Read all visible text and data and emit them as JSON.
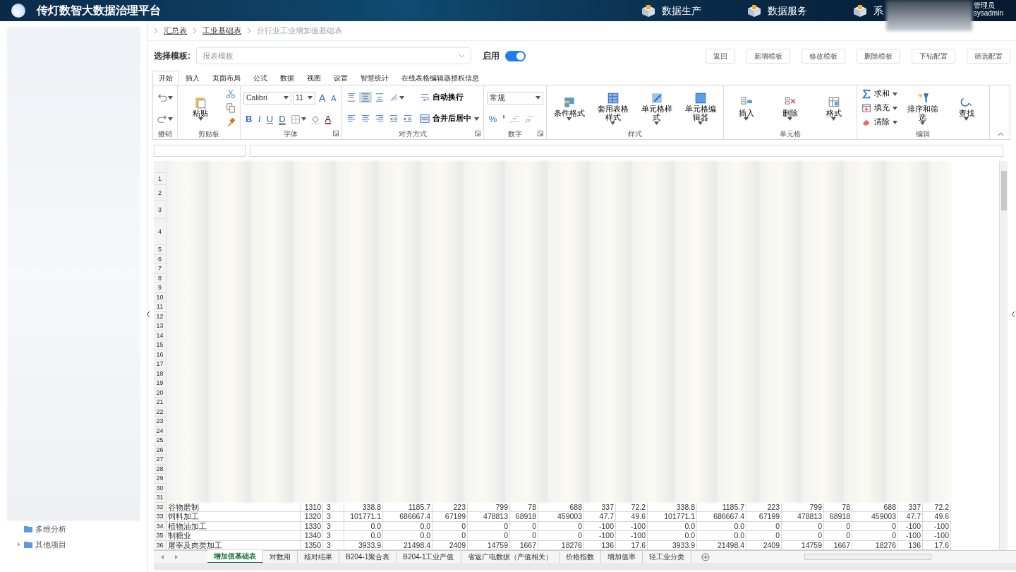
{
  "header": {
    "title": "传灯数智大数据治理平台",
    "nav": [
      {
        "label": "数据生产"
      },
      {
        "label": "数据服务"
      },
      {
        "label": "系"
      }
    ],
    "user": {
      "role": "管理员",
      "name": "sysadmin"
    }
  },
  "sidebar": {
    "items": [
      {
        "label": "多维分析",
        "expandable": false
      },
      {
        "label": "其他项目",
        "expandable": true
      }
    ]
  },
  "breadcrumb": [
    "汇总表",
    "工业基础表",
    "分行业工业增加值基础表"
  ],
  "template_bar": {
    "label": "选择模板:",
    "select": {
      "placeholder": "报表模板"
    },
    "switch": {
      "label": "启用",
      "on": true
    },
    "buttons": [
      "返回",
      "新增模板",
      "修改模板",
      "删除模板",
      "下钻配置",
      "筛选配置"
    ]
  },
  "ribbon": {
    "tabs": [
      {
        "label": "开始",
        "selected": true
      },
      {
        "label": "插入",
        "selected": false
      },
      {
        "label": "页面布局",
        "selected": false
      },
      {
        "label": "公式",
        "selected": false
      },
      {
        "label": "数据",
        "selected": false
      },
      {
        "label": "视图",
        "selected": false
      },
      {
        "label": "设置",
        "selected": false
      },
      {
        "label": "智慧统计",
        "selected": false
      },
      {
        "label": "在线表格编辑器授权信息",
        "selected": false
      }
    ],
    "groups": [
      {
        "label": "撤销",
        "launcher": false,
        "sections": [
          [
            [
              {
                "kind": "icon",
                "caret": true
              }
            ],
            [
              {
                "kind": "icon",
                "caret": true
              }
            ]
          ]
        ]
      },
      {
        "label": "剪贴板",
        "launcher": false,
        "sections": [
          [
            [
              {
                "kind": "big",
                "label": "粘贴",
                "caret": true
              }
            ]
          ],
          [
            [
              {
                "kind": "icon",
                "caret": false
              }
            ],
            [
              {
                "kind": "icon",
                "caret": false
              }
            ],
            [
              {
                "kind": "icon",
                "caret": false
              }
            ]
          ]
        ]
      },
      {
        "label": "字体",
        "launcher": true,
        "sections": [
          [
            [
              {
                "kind": "select",
                "value": "Calibri"
              },
              {
                "kind": "select",
                "value": "11"
              },
              {
                "kind": "glyph",
                "text": "A"
              },
              {
                "kind": "glyph",
                "text": "A"
              }
            ],
            [
              {
                "kind": "glyph",
                "text": "B"
              },
              {
                "kind": "glyph",
                "text": "I"
              },
              {
                "kind": "glyph",
                "text": "U"
              },
              {
                "kind": "glyph",
                "text": "D"
              },
              {
                "kind": "icon",
                "caret": true
              },
              {
                "kind": "icon",
                "caret": false
              },
              {
                "kind": "glyph",
                "text": "A"
              }
            ]
          ]
        ]
      },
      {
        "label": "对齐方式",
        "launcher": true,
        "sections": [
          [
            [
              {
                "kind": "toggle",
                "selected": false
              },
              {
                "kind": "toggle",
                "selected": true
              },
              {
                "kind": "toggle",
                "selected": false
              },
              {
                "kind": "icon",
                "caret": true
              }
            ],
            [
              {
                "kind": "toggle",
                "selected": false
              },
              {
                "kind": "toggle",
                "selected": false
              },
              {
                "kind": "toggle",
                "selected": false
              },
              {
                "kind": "icon",
                "caret": false
              },
              {
                "kind": "icon",
                "caret": false
              }
            ]
          ],
          [
            [
              {
                "kind": "small",
                "label": "自动换行",
                "caret": false
              }
            ],
            [
              {
                "kind": "small",
                "label": "合并后居中",
                "caret": true
              }
            ]
          ]
        ]
      },
      {
        "label": "数字",
        "launcher": true,
        "sections": [
          [
            [
              {
                "kind": "select",
                "value": "常规"
              }
            ],
            [
              {
                "kind": "glyph",
                "text": "%"
              },
              {
                "kind": "glyph",
                "text": "❜"
              },
              {
                "kind": "icon",
                "caret": false
              },
              {
                "kind": "icon",
                "caret": false
              }
            ]
          ]
        ]
      },
      {
        "label": "样式",
        "launcher": false,
        "sections": [
          [
            [
              {
                "kind": "big",
                "label": "条件格式",
                "caret": true
              }
            ]
          ],
          [
            [
              {
                "kind": "big",
                "label": "套用表格样式",
                "caret": true
              }
            ]
          ],
          [
            [
              {
                "kind": "big",
                "label": "单元格样式",
                "caret": true
              }
            ]
          ],
          [
            [
              {
                "kind": "big",
                "label": "单元格编辑器",
                "caret": true
              }
            ]
          ]
        ]
      },
      {
        "label": "单元格",
        "launcher": false,
        "sections": [
          [
            [
              {
                "kind": "big",
                "label": "插入",
                "caret": true
              }
            ]
          ],
          [
            [
              {
                "kind": "big",
                "label": "删除",
                "caret": true
              }
            ]
          ],
          [
            [
              {
                "kind": "big",
                "label": "格式",
                "caret": true
              }
            ]
          ]
        ]
      },
      {
        "label": "编辑",
        "launcher": false,
        "sections": [
          [
            [
              {
                "kind": "small",
                "label": "求和",
                "caret": true
              }
            ],
            [
              {
                "kind": "small",
                "label": "填充",
                "caret": true
              }
            ],
            [
              {
                "kind": "small",
                "label": "清除",
                "caret": true
              }
            ]
          ],
          [
            [
              {
                "kind": "big",
                "label": "排序和筛选",
                "caret": true
              }
            ]
          ],
          [
            [
              {
                "kind": "big",
                "label": "查找",
                "caret": true
              }
            ]
          ]
        ]
      }
    ]
  },
  "sheet": {
    "row_numbers": [
      "1",
      "2",
      "3",
      "4",
      "5",
      "6",
      "7",
      "8",
      "9",
      "10",
      "11",
      "12",
      "13",
      "14",
      "15",
      "16",
      "17",
      "18",
      "19",
      "20",
      "21",
      "22",
      "23",
      "24",
      "25",
      "26",
      "27",
      "28",
      "29",
      "30",
      "31"
    ],
    "rows": [
      {
        "number": "32",
        "cells": [
          "谷物磨制",
          "1310",
          "3",
          "338.8",
          "1185.7",
          "223",
          "799",
          "78",
          "688",
          "337",
          "72.2",
          "338.8",
          "1185.7",
          "223",
          "799",
          "78",
          "688",
          "337",
          "72.2"
        ]
      },
      {
        "number": "33",
        "cells": [
          "饲料加工",
          "1320",
          "3",
          "101771.1",
          "686667.4",
          "67199",
          "478813",
          "68918",
          "459003",
          "47.7",
          "49.6",
          "101771.1",
          "686667.4",
          "67199",
          "478813",
          "68918",
          "459003",
          "47.7",
          "49.6"
        ]
      },
      {
        "number": "34",
        "cells": [
          "植物油加工",
          "1330",
          "3",
          "0.0",
          "0.0",
          "0",
          "0",
          "0",
          "0",
          "-100",
          "-100",
          "0.0",
          "0.0",
          "0",
          "0",
          "0",
          "0",
          "-100",
          "-100"
        ]
      },
      {
        "number": "35",
        "cells": [
          "制糖业",
          "1340",
          "3",
          "0.0",
          "0.0",
          "0",
          "0",
          "0",
          "0",
          "-100",
          "-100",
          "0.0",
          "0.0",
          "0",
          "0",
          "0",
          "0",
          "-100",
          "-100"
        ]
      },
      {
        "number": "36",
        "cells": [
          "屠宰及肉类加工",
          "1350",
          "3",
          "3933.9",
          "21498.4",
          "2409",
          "14759",
          "1667",
          "18276",
          "136",
          "17.6",
          "3933.9",
          "21498.4",
          "2409",
          "14759",
          "1667",
          "18276",
          "136",
          "17.6"
        ]
      }
    ],
    "tabs": [
      {
        "label": "增加值基础表",
        "selected": true
      },
      {
        "label": "对数用",
        "selected": false
      },
      {
        "label": "核对结果",
        "selected": false
      },
      {
        "label": "B204-1聚合表",
        "selected": false
      },
      {
        "label": "B204-1工业产值",
        "selected": false
      },
      {
        "label": "省返广电数据（产值相关）",
        "selected": false
      },
      {
        "label": "价格指数",
        "selected": false
      },
      {
        "label": "增加值率",
        "selected": false
      },
      {
        "label": "轻工业分类",
        "selected": false
      }
    ]
  }
}
